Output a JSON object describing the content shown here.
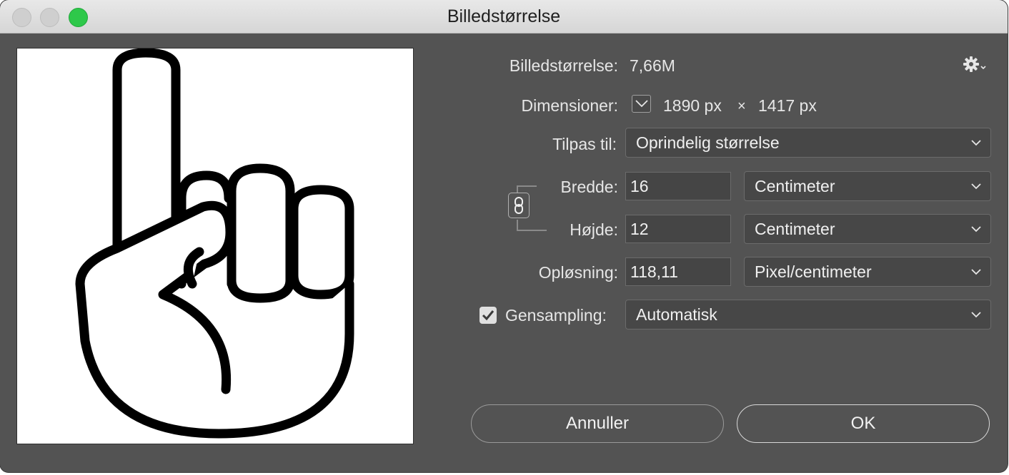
{
  "window": {
    "title": "Billedstørrelse"
  },
  "image_size": {
    "label": "Billedstørrelse:",
    "value": "7,66M"
  },
  "dimensions": {
    "label": "Dimensioner:",
    "width": "1890 px",
    "separator": "×",
    "height": "1417 px"
  },
  "fit_to": {
    "label": "Tilpas til:",
    "value": "Oprindelig størrelse"
  },
  "width": {
    "label": "Bredde:",
    "value": "16",
    "unit": "Centimeter"
  },
  "height": {
    "label": "Højde:",
    "value": "12",
    "unit": "Centimeter"
  },
  "resolution": {
    "label": "Opløsning:",
    "value": "118,11",
    "unit": "Pixel/centimeter"
  },
  "resample": {
    "label": "Gensampling:",
    "checked": true,
    "value": "Automatisk"
  },
  "buttons": {
    "cancel": "Annuller",
    "ok": "OK"
  },
  "icons": {
    "gear": "gear-icon",
    "dimensions_toggle": "chevron-down-icon",
    "link": "chain-link-icon",
    "checkbox": "checkmark-icon",
    "select": "chevron-down-icon"
  },
  "colors": {
    "dialog_bg": "#535353",
    "field_bg": "#454545",
    "text": "#e6e6e6",
    "zoom_button": "#2ec84a"
  }
}
